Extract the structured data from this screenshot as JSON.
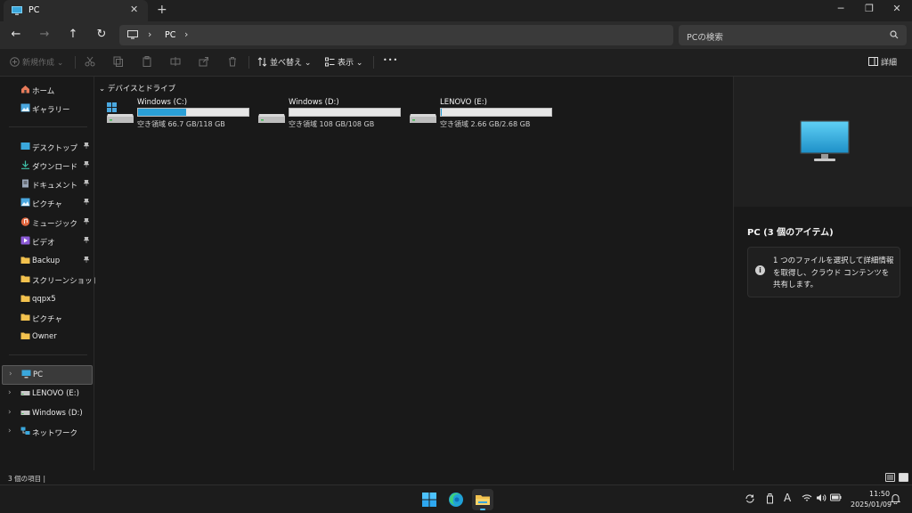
{
  "window": {
    "tab_title": "PC",
    "close_tab": "✕",
    "new_tab": "+",
    "minimize": "─",
    "restore": "❐",
    "close": "✕"
  },
  "nav": {
    "back": "←",
    "forward": "→",
    "up": "↑",
    "refresh": "↻",
    "breadcrumb_sep": "›",
    "breadcrumb": [
      "PC"
    ],
    "search_placeholder": "PCの検索"
  },
  "toolbar": {
    "new_label": "新規作成",
    "sort_label": "並べ替え",
    "view_label": "表示",
    "more_label": "•••",
    "details_label": "詳細",
    "dropdown_glyph": "⌄"
  },
  "sidebar": {
    "quick": [
      {
        "label": "ホーム",
        "icon": "home-icon",
        "pinned": false
      },
      {
        "label": "ギャラリー",
        "icon": "gallery-icon",
        "pinned": false
      }
    ],
    "pinned": [
      {
        "label": "デスクトップ",
        "icon": "desktop-folder-icon"
      },
      {
        "label": "ダウンロード",
        "icon": "download-icon"
      },
      {
        "label": "ドキュメント",
        "icon": "document-icon"
      },
      {
        "label": "ピクチャ",
        "icon": "pictures-icon"
      },
      {
        "label": "ミュージック",
        "icon": "music-icon"
      },
      {
        "label": "ビデオ",
        "icon": "video-icon"
      },
      {
        "label": "Backup",
        "icon": "folder-icon"
      }
    ],
    "folders": [
      {
        "label": "スクリーンショット",
        "icon": "folder-icon"
      },
      {
        "label": "qqpx5",
        "icon": "folder-icon"
      },
      {
        "label": "ピクチャ",
        "icon": "folder-icon"
      },
      {
        "label": "Owner",
        "icon": "folder-icon"
      }
    ],
    "tree": [
      {
        "label": "PC",
        "icon": "monitor-icon",
        "selected": true
      },
      {
        "label": "LENOVO (E:)",
        "icon": "drive-icon",
        "selected": false
      },
      {
        "label": "Windows (D:)",
        "icon": "drive-icon",
        "selected": false
      },
      {
        "label": "ネットワーク",
        "icon": "network-icon",
        "selected": false
      }
    ],
    "pin_glyph": "📌",
    "expand_glyph": "›"
  },
  "content": {
    "group_label": "デバイスとドライブ",
    "group_chevron": "⌄",
    "drives": [
      {
        "name": "Windows (C:)",
        "space": "空き領域 66.7 GB/118 GB",
        "used_fraction": 0.435,
        "system": true
      },
      {
        "name": "Windows (D:)",
        "space": "空き領域 108 GB/108 GB",
        "used_fraction": 0.0,
        "system": false
      },
      {
        "name": "LENOVO (E:)",
        "space": "空き領域 2.66 GB/2.68 GB",
        "used_fraction": 0.007,
        "system": false
      }
    ]
  },
  "details": {
    "title": "PC (3 個のアイテム)",
    "info_text": "1 つのファイルを選択して詳細情報を取得し、クラウド コンテンツを共有します。",
    "info_glyph": "i"
  },
  "status": {
    "item_count": "3 個の項目  |"
  },
  "taskbar": {
    "time": "11:50",
    "date": "2025/01/09",
    "ime": "A"
  },
  "colors": {
    "accent": "#2a9fd6",
    "background": "#191919",
    "folder": "#f2c14e"
  }
}
